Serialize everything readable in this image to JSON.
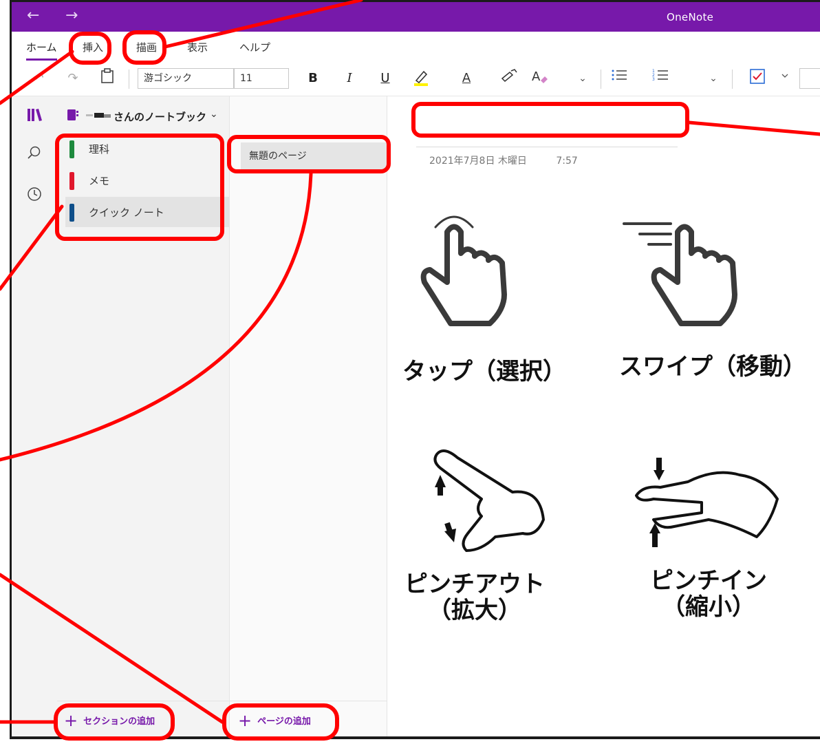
{
  "titlebar": {
    "back": "←",
    "forward": "→",
    "title": "OneNote"
  },
  "ribbon": {
    "tabs": [
      "ホーム",
      "挿入",
      "描画",
      "表示",
      "ヘルプ"
    ]
  },
  "toolbar": {
    "font_name": "游ゴシック",
    "font_size": "11",
    "bold": "B",
    "italic": "I",
    "underline": "U",
    "font_color": "A"
  },
  "notebook": {
    "name": "さんのノートブック",
    "sections": [
      {
        "label": "理科",
        "color": "#1e8a3e"
      },
      {
        "label": "メモ",
        "color": "#e0182d"
      },
      {
        "label": "クイック ノート",
        "color": "#0f4f8a"
      }
    ],
    "add_section": "セクションの追加"
  },
  "pages": {
    "items": [
      "無題のページ"
    ],
    "add_page": "ページの追加"
  },
  "page": {
    "title": "",
    "date": "2021年7月8日 木曜日",
    "time": "7:57"
  },
  "gestures": {
    "tap": "タップ（選択）",
    "swipe": "スワイプ（移動）",
    "pinch_out_line1": "ピンチアウト",
    "pinch_out_line2": "（拡大）",
    "pinch_in_line1": "ピンチイン",
    "pinch_in_line2": "（縮小）"
  },
  "colors": {
    "accent": "#7719aa",
    "annotation": "#ff0000"
  }
}
